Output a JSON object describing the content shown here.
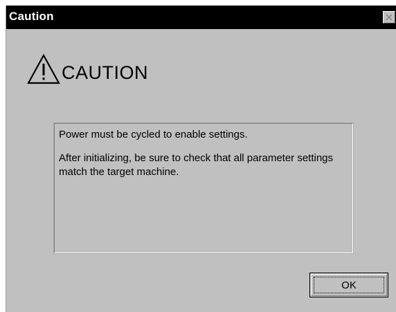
{
  "window": {
    "title": "Caution",
    "close_icon": "close-icon"
  },
  "header": {
    "icon": "warning-icon",
    "heading": "CAUTION"
  },
  "message": {
    "line1": "Power must be cycled to enable settings.",
    "line2": "After initializing, be sure to check that all parameter settings match the target machine."
  },
  "buttons": {
    "ok_label": "OK"
  },
  "colors": {
    "titlebar": "#000000",
    "dialog_face": "#c0c0c0",
    "title_text": "#ffffff"
  }
}
